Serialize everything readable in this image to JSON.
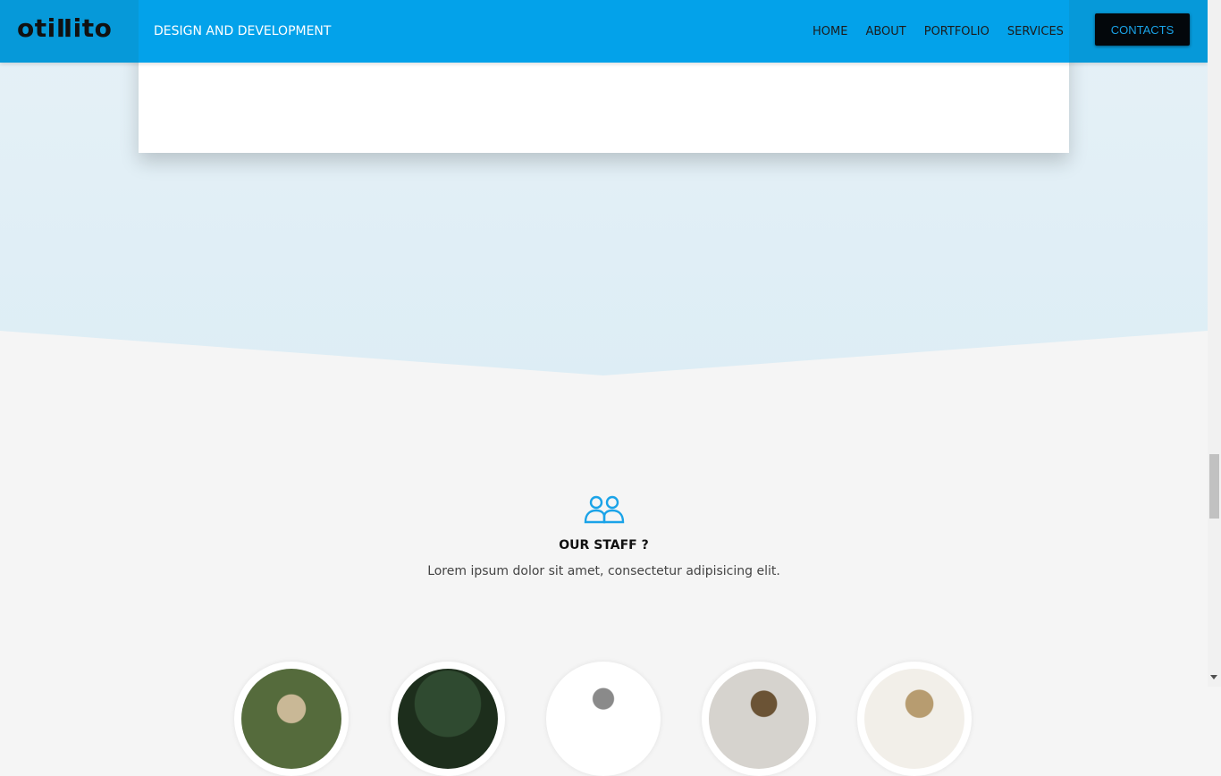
{
  "header": {
    "logo_text": "otiⅡito",
    "tagline": "DESIGN AND DEVELOPMENT",
    "nav": [
      {
        "label": "HOME"
      },
      {
        "label": "ABOUT"
      },
      {
        "label": "PORTFOLIO"
      },
      {
        "label": "SERVICES"
      }
    ],
    "contacts_label": "CONTACTS"
  },
  "staff": {
    "icon": "people-icon",
    "title": "OUR STAFF ?",
    "description": "Lorem ipsum dolor sit amet, consectetur adipisicing elit.",
    "members": [
      {
        "photo": "staff-photo-1"
      },
      {
        "photo": "staff-photo-2"
      },
      {
        "photo": "staff-photo-3"
      },
      {
        "photo": "staff-photo-4"
      },
      {
        "photo": "staff-photo-5"
      }
    ]
  },
  "colors": {
    "header": "#03a2ea",
    "header_side": "#0699d9",
    "accent": "#1aa3e8",
    "section_top": "#e6f1f7",
    "section_bottom": "#f5f5f5"
  }
}
